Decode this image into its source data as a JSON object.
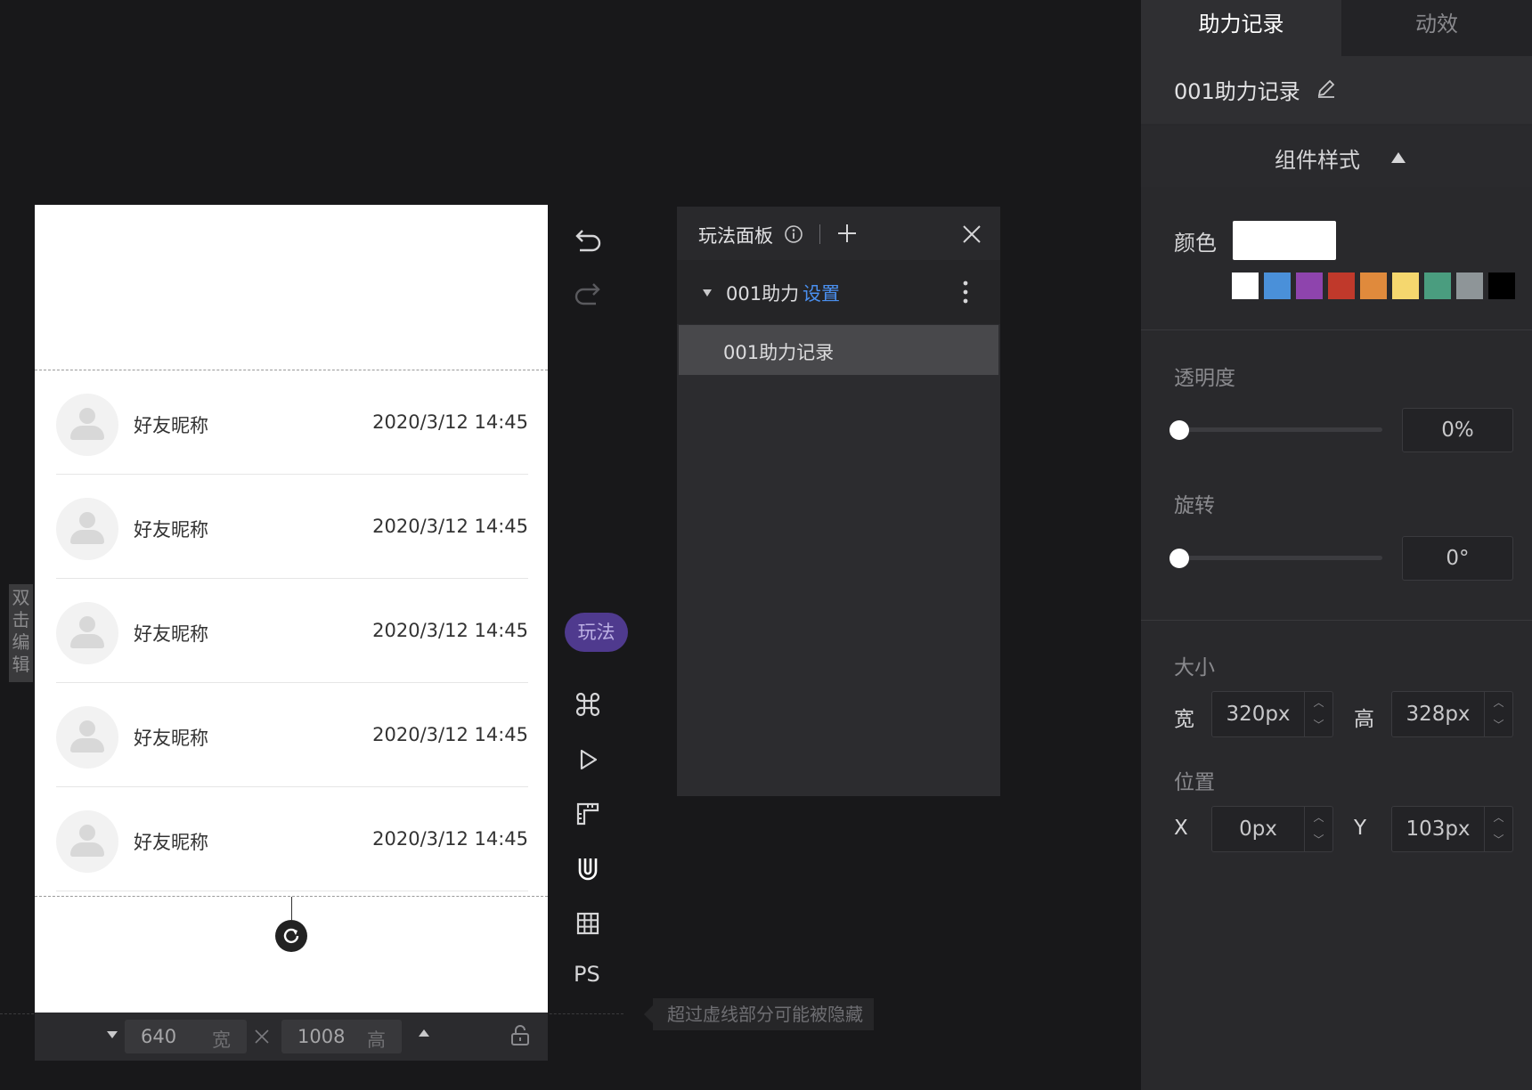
{
  "canvas": {
    "rows": [
      {
        "name": "好友昵称",
        "time": "2020/3/12 14:45"
      },
      {
        "name": "好友昵称",
        "time": "2020/3/12 14:45"
      },
      {
        "name": "好友昵称",
        "time": "2020/3/12 14:45"
      },
      {
        "name": "好友昵称",
        "time": "2020/3/12 14:45"
      },
      {
        "name": "好友昵称",
        "time": "2020/3/12 14:45"
      }
    ],
    "side_tag": "双击编辑"
  },
  "size_bar": {
    "width_value": "640",
    "width_unit": "宽",
    "height_value": "1008",
    "height_unit": "高"
  },
  "hint": "超过虚线部分可能被隐藏",
  "toolbar": {
    "play_badge": "玩法",
    "ps_label": "PS"
  },
  "panel": {
    "title": "玩法面板",
    "group_name": "001助力",
    "group_link": "设置",
    "item_label": "001助力记录"
  },
  "inspector": {
    "tabs": [
      "助力记录",
      "动效"
    ],
    "component_name": "001助力记录",
    "style_section": "组件样式",
    "color_label": "颜色",
    "swatches": [
      "#ffffff",
      "#4a90d9",
      "#8e44ad",
      "#c0392b",
      "#e08a3c",
      "#f5d76e",
      "#4a9d7f",
      "#8e9598",
      "#000000"
    ],
    "selected_color": "#ffffff",
    "opacity_label": "透明度",
    "opacity_value": "0%",
    "rotation_label": "旋转",
    "rotation_value": "0°",
    "size_label": "大小",
    "width_label": "宽",
    "width_value": "320px",
    "height_label": "高",
    "height_value": "328px",
    "position_label": "位置",
    "x_label": "X",
    "x_value": "0px",
    "y_label": "Y",
    "y_value": "103px"
  }
}
